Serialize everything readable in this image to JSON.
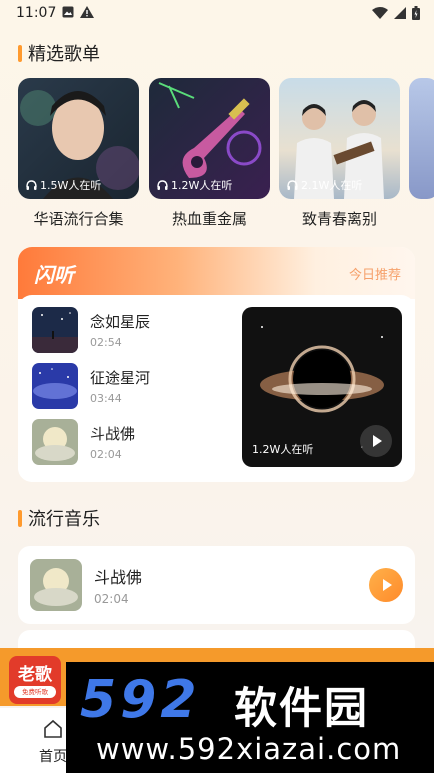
{
  "status_bar": {
    "time": "11:07",
    "left_icons": [
      "image-icon",
      "warning-icon"
    ],
    "right_icons": [
      "wifi-icon",
      "signal-icon",
      "battery-icon"
    ]
  },
  "featured": {
    "title": "精选歌单",
    "playlists": [
      {
        "name": "华语流行合集",
        "listeners": "1.5W人在听",
        "cover": "male-portrait-cover"
      },
      {
        "name": "热血重金属",
        "listeners": "1.2W人在听",
        "cover": "guitar-cover"
      },
      {
        "name": "致青春离别",
        "listeners": "2.1W人在听",
        "cover": "students-cover"
      }
    ]
  },
  "flash": {
    "title": "闪听",
    "today_label": "今日推荐",
    "songs": [
      {
        "name": "念如星辰",
        "duration": "02:54"
      },
      {
        "name": "征途星河",
        "duration": "03:44"
      },
      {
        "name": "斗战佛",
        "duration": "02:04"
      }
    ],
    "feature": {
      "listeners": "1.2W人在听"
    }
  },
  "popular": {
    "title": "流行音乐",
    "songs": [
      {
        "name": "斗战佛",
        "duration": "02:04"
      }
    ]
  },
  "nav": {
    "home_label": "首页"
  },
  "watermark": {
    "logo_text": "老歌",
    "logo_sub": "免费听歌",
    "brand_number": "592",
    "brand_cn": "软件园",
    "url": "www.592xiazai.com"
  },
  "colors": {
    "accent": "#ff9a2e",
    "flash_header": "#ff7a3a",
    "watermark_orange": "#f59a2b",
    "watermark_blue": "#3f78e8"
  }
}
